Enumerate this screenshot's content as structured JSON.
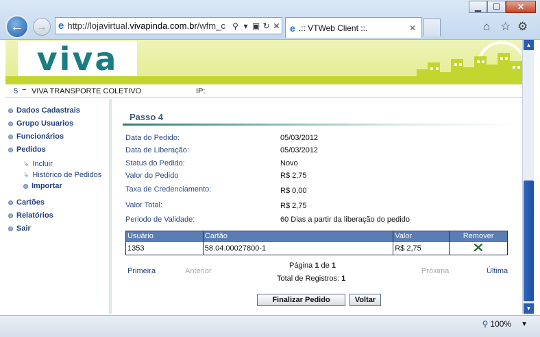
{
  "browser": {
    "url_prefix": "http://lojavirtual.",
    "url_domain": "vivapinda.com.br",
    "url_suffix": "/wfm_c",
    "tab_title": ".:: VTWeb Client ::.",
    "zoom": "100%"
  },
  "site": {
    "logo_text": "viva",
    "info_number": "5",
    "info_dash": "−",
    "company": "VIVA TRANSPORTE COLETIVO",
    "ip_label": "IP:"
  },
  "menu": {
    "dados": "Dados Cadastrais",
    "grupo": "Grupo Usuarios",
    "funcionarios": "Funcionários",
    "pedidos": "Pedidos",
    "incluir": "Incluir",
    "historico": "Histórico de Pedidos",
    "importar": "Importar",
    "cartoes": "Cartões",
    "relatorios": "Relatórios",
    "sair": "Sair"
  },
  "order": {
    "step_title": "Passo 4",
    "data_pedido_label": "Data do Pedido:",
    "data_pedido": "05/03/2012",
    "data_liberacao_label": "Data de Liberação:",
    "data_liberacao": "05/03/2012",
    "status_label": "Status do Pedido:",
    "status": "Novo",
    "valor_label": "Valor do Pedido",
    "valor": "R$ 2,75",
    "taxa_label": "Taxa de Credenciamento:",
    "taxa": "R$ 0,00",
    "total_label": "Valor Total:",
    "total": "R$ 2,75",
    "validade_label": "Periodo de Validade:",
    "validade": "60 Dias a partir da liberação do pedido"
  },
  "table": {
    "headers": {
      "usuario": "Usuário",
      "cartao": "Cartão",
      "valor": "Valor",
      "remover": "Remover"
    },
    "rows": [
      {
        "usuario": "1353",
        "cartao": "58.04.00027800-1",
        "valor": "R$ 2,75",
        "remover_icon": "delete-x-icon"
      }
    ]
  },
  "pager": {
    "primeira": "Primeira",
    "anterior": "Anterior",
    "pagina_label": "Página",
    "pagina_atual": "1",
    "de_label": "de",
    "pagina_total": "1",
    "proxima": "Próxima",
    "ultima": "Última",
    "total_registros_label": "Total de Registros:",
    "total_registros": "1"
  },
  "buttons": {
    "finalizar": "Finalizar Pedido",
    "voltar": "Voltar"
  },
  "colors": {
    "banner": "#e2ec8e",
    "table_header": "#5a7db3",
    "link": "#203e7c",
    "remove_icon": "#2d6b34"
  }
}
